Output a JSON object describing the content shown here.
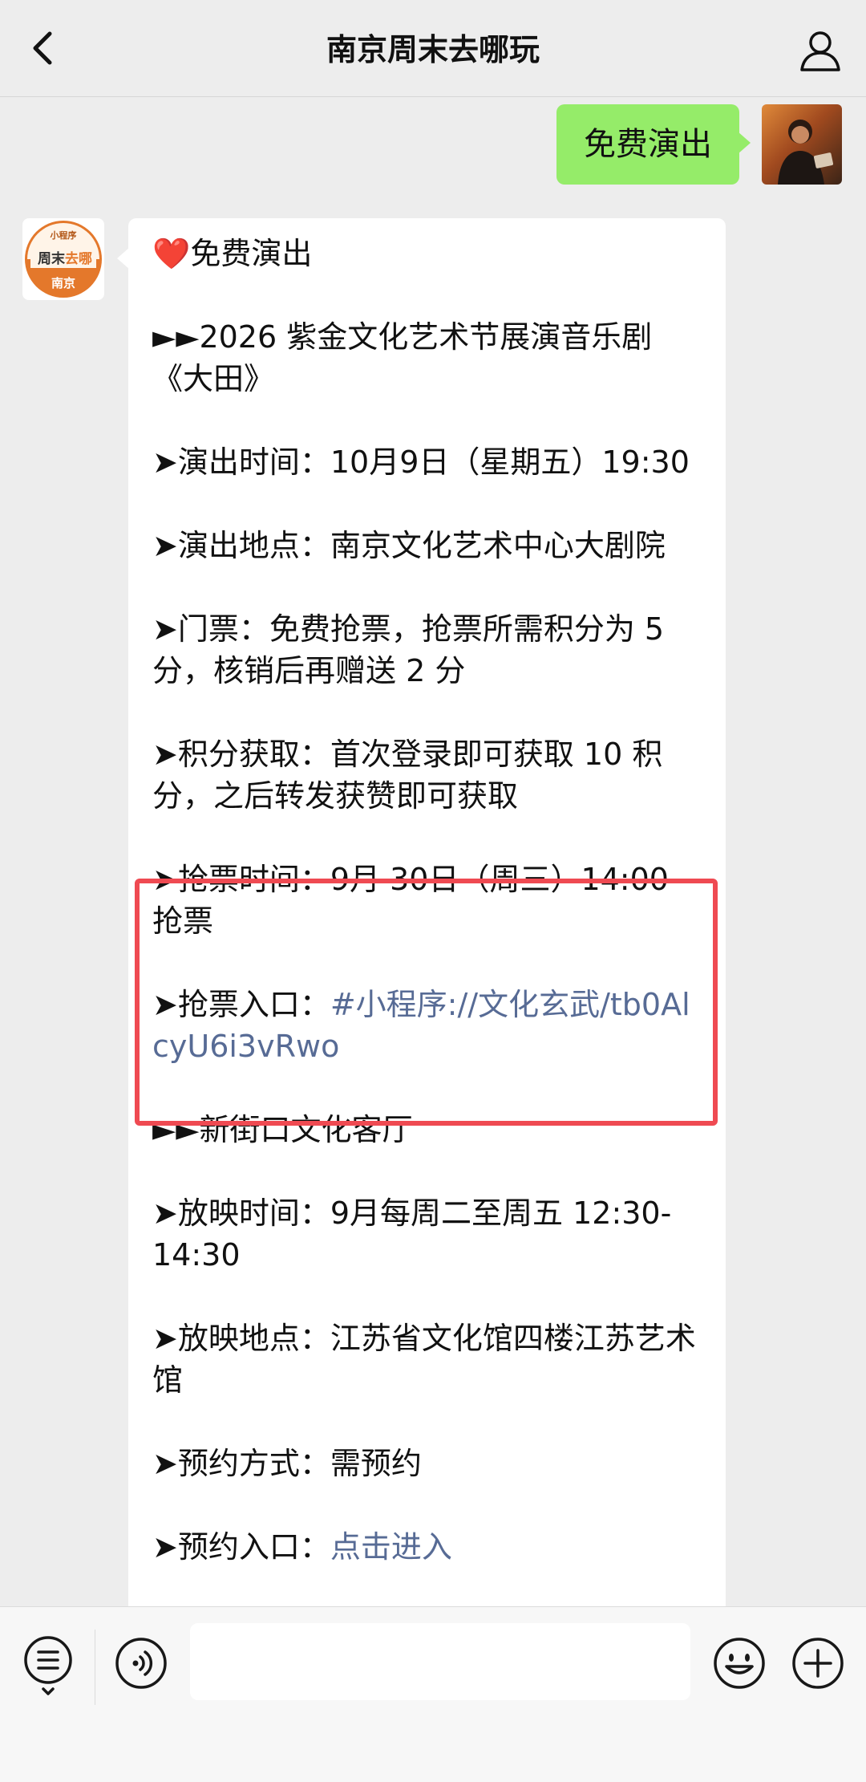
{
  "header": {
    "title": "南京周末去哪玩",
    "back_icon": "chevron-left-icon",
    "profile_icon": "person-icon"
  },
  "outgoing": {
    "text": "免费演出"
  },
  "bot_avatar": {
    "line1": "小程序",
    "line2a": "周末",
    "line2b": "去哪",
    "line3": "南京",
    "brand_color": "#e4782b"
  },
  "message": {
    "heart_icon": "❤️",
    "heading": "免费演出",
    "event_title": "►►2026 紫金文化艺术节展演音乐剧《大田》",
    "show_time": "➤演出时间：10月9日（星期五）19:30",
    "venue": "➤演出地点：南京文化艺术中心大剧院",
    "ticket": "➤门票：免费抢票，抢票所需积分为 5 分，核销后再赠送 2 分",
    "points": "➤积分获取：首次登录即可获取 10 积分，之后转发获赞即可获取",
    "grab_time": "➤抢票时间：9月 30日（周三）14:00 抢票",
    "grab_entry_label": "➤抢票入口：",
    "grab_entry_link": "#小程序://文化玄武/tb0AlcyU6i3vRwo",
    "section2_title": "►►新街口文化客厅",
    "screening_time": "➤放映时间：9月每周二至周五 12:30-14:30",
    "screening_venue": "➤放映地点：江苏省文化馆四楼江苏艺术馆",
    "booking_method": "➤预约方式：需预约",
    "booking_entry_label": "➤预约入口：",
    "booking_entry_link": "点击进入"
  },
  "colors": {
    "highlight_border": "#ef4a52",
    "link": "#576b95",
    "outgoing_bubble": "#95ec69"
  },
  "input_bar": {
    "placeholder": "",
    "menu_icon": "list-menu-icon",
    "voice_icon": "voice-icon",
    "emoji_icon": "emoji-icon",
    "plus_icon": "plus-icon"
  }
}
